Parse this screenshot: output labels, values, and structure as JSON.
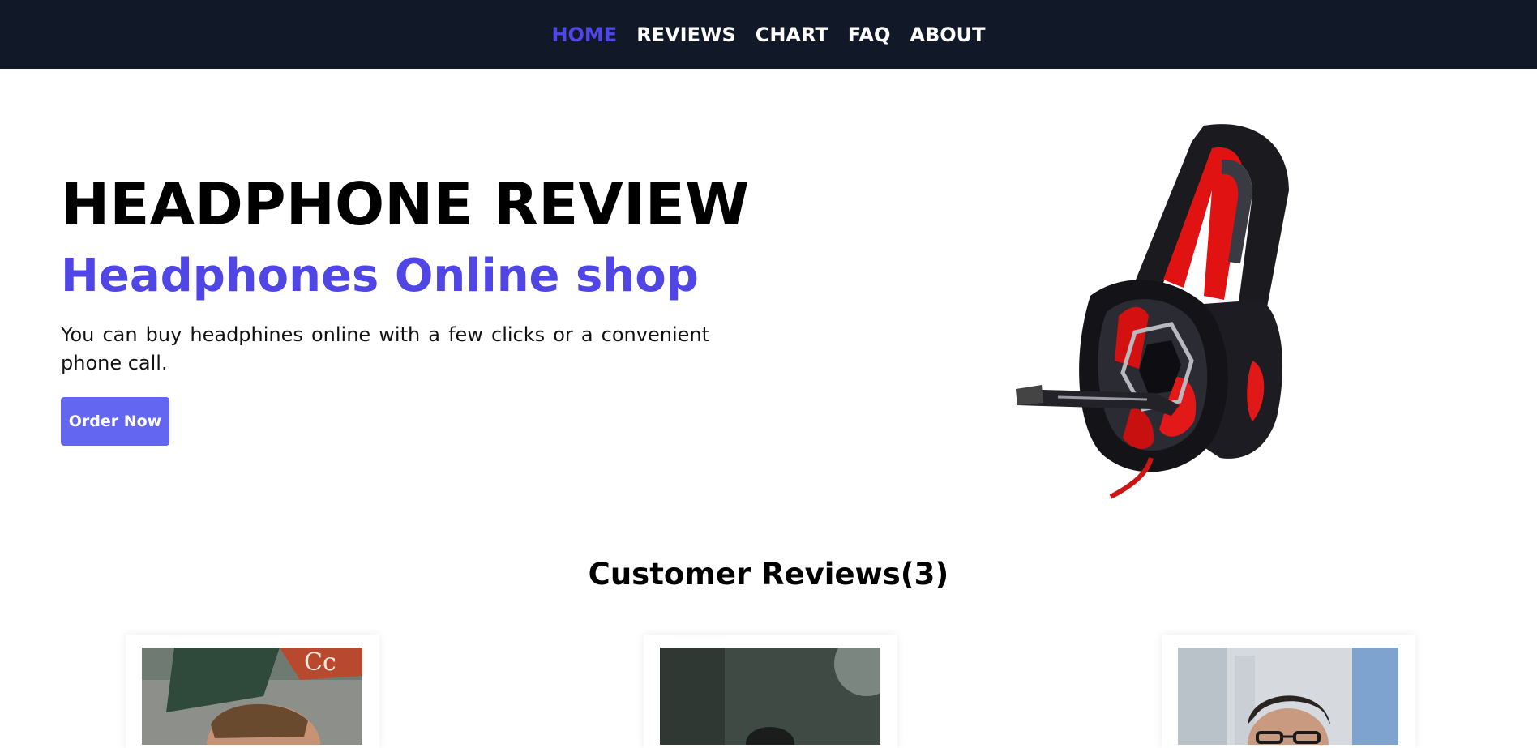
{
  "nav": {
    "items": [
      {
        "label": "HOME",
        "active": true
      },
      {
        "label": "REVIEWS",
        "active": false
      },
      {
        "label": "CHART",
        "active": false
      },
      {
        "label": "FAQ",
        "active": false
      },
      {
        "label": "ABOUT",
        "active": false
      }
    ]
  },
  "hero": {
    "title": "HEADPHONE REVIEW",
    "subtitle": "Headphones Online shop",
    "description": "You can buy headphines online with a few clicks or a convenient phone call.",
    "cta_label": "Order Now"
  },
  "reviews": {
    "heading": "Customer Reviews(3)"
  },
  "colors": {
    "nav_bg": "#111827",
    "accent": "#4f46e5",
    "button_bg": "#6366f1"
  }
}
